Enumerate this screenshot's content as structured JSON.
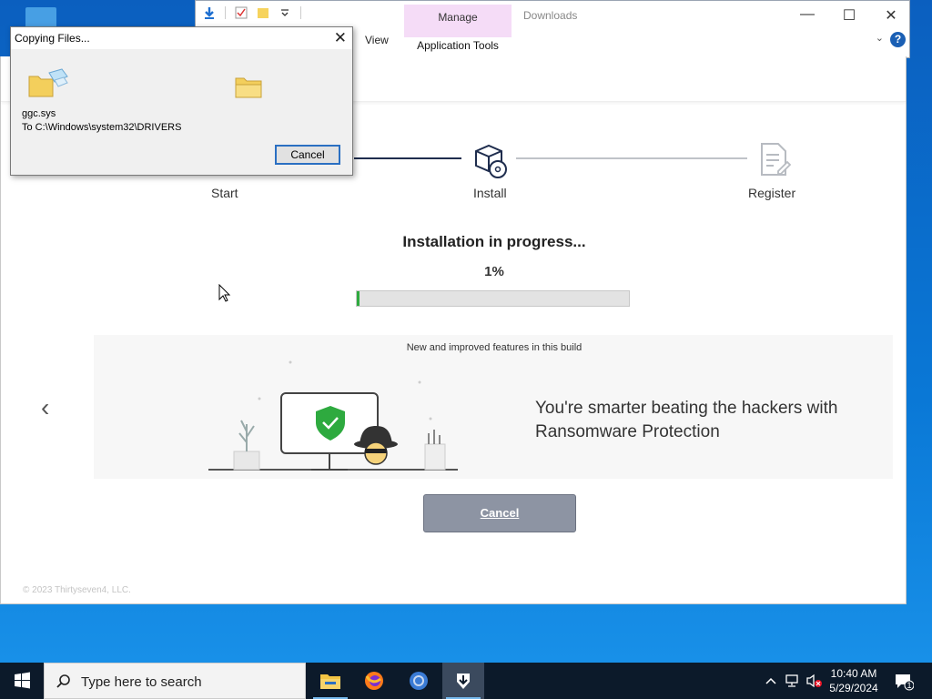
{
  "explorer": {
    "manage_tab": "Manage",
    "application_tools_tab": "Application Tools",
    "view_tab": "View",
    "location_title": "Downloads"
  },
  "installer": {
    "steps": [
      {
        "label": "Start",
        "status": "done"
      },
      {
        "label": "Install",
        "status": "active"
      },
      {
        "label": "Register",
        "status": "pending"
      }
    ],
    "progress_title": "Installation in progress...",
    "progress_percent_text": "1%",
    "progress_value": 0.01,
    "carousel_caption": "New and improved features in this build",
    "carousel_text": "You're smarter beating the hackers with Ransomware Protection",
    "cancel_label": "Cancel",
    "copyright": "© 2023 Thirtyseven4, LLC."
  },
  "copy_dialog": {
    "title": "Copying Files...",
    "file_name": "ggc.sys",
    "destination": "To C:\\Windows\\system32\\DRIVERS",
    "cancel_label": "Cancel"
  },
  "taskbar": {
    "search_placeholder": "Type here to search",
    "time": "10:40 AM",
    "date": "5/29/2024",
    "notification_count": "1",
    "apps": [
      "file-explorer",
      "firefox",
      "chrome",
      "installer"
    ]
  },
  "colors": {
    "accent_dark": "#1f2d4e",
    "progress_green": "#2eaa3f",
    "manage_tab_bg": "#f5dcf7",
    "cancel_button_bg": "#8d94a3"
  }
}
